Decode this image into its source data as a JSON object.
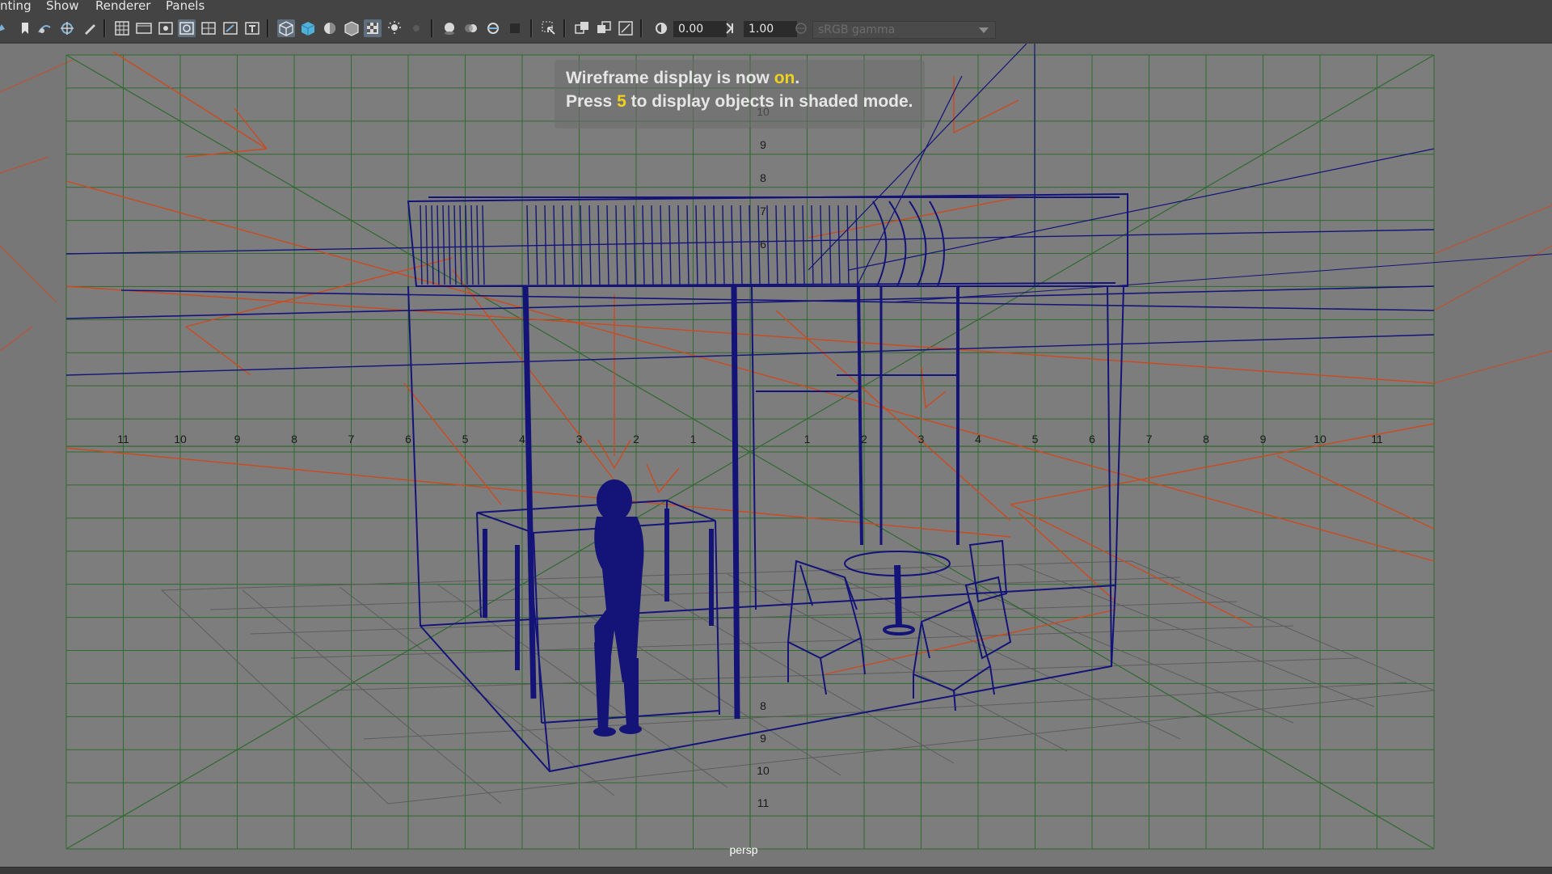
{
  "menu": {
    "items": [
      "nting",
      "Show",
      "Renderer",
      "Panels"
    ]
  },
  "toolbar": {
    "exposure_value": "0.00",
    "gamma_value": "1.00",
    "color_space": "sRGB gamma",
    "icons": [
      "select-camera-icon",
      "bookmark-icon",
      "camera-tumble-icon",
      "camera-track-icon",
      "grease-pencil-icon",
      "grid-icon",
      "film-gate-icon",
      "resolution-gate-icon",
      "gate-mask-icon",
      "field-chart-icon",
      "safe-action-icon",
      "safe-title-icon",
      "wireframe-icon",
      "smooth-shade-icon",
      "default-material-icon",
      "wireframe-on-shaded-icon",
      "textured-icon",
      "use-all-lights-icon",
      "shadows-icon",
      "screen-space-ao-icon",
      "motion-blur-icon",
      "multisample-aa-icon",
      "depth-of-field-icon",
      "isolate-select-icon",
      "xray-icon",
      "xray-joints-icon",
      "backface-culling-icon",
      "exposure-icon",
      "gamma-icon",
      "color-management-icon"
    ]
  },
  "viewport": {
    "message_line1_prefix": "Wireframe display is now ",
    "message_line1_highlight": "on",
    "message_line1_suffix": ".",
    "message_line2_prefix": "Press ",
    "message_line2_highlight": "5",
    "message_line2_suffix": " to display objects in shaded mode.",
    "camera_label": "persp",
    "grid_labels_left": [
      "11",
      "10",
      "9",
      "8",
      "7",
      "6",
      "5",
      "4",
      "3",
      "2",
      "1"
    ],
    "grid_labels_right": [
      "1",
      "2",
      "3",
      "4",
      "5",
      "6",
      "7",
      "8",
      "9",
      "10",
      "11"
    ],
    "grid_labels_up": [
      "10",
      "9",
      "8",
      "7",
      "6"
    ],
    "grid_labels_down": [
      "8",
      "9",
      "10",
      "11"
    ],
    "colors": {
      "viewport_bg": "#7c7c7c",
      "grid_green": "#2f6a2f",
      "wireframe_blue": "#141478",
      "light_red": "#cc4a20",
      "highlight_yellow": "#f0d21c"
    }
  }
}
